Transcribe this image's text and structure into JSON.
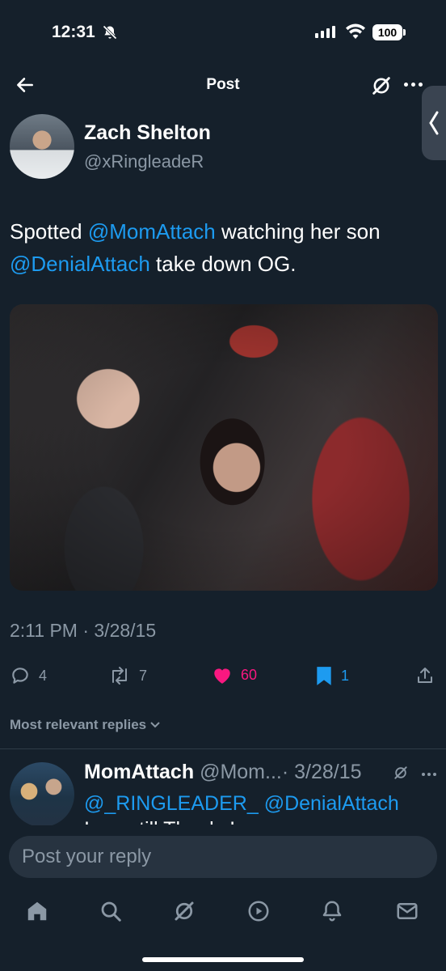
{
  "status_bar": {
    "time": "12:31",
    "battery": "100"
  },
  "header": {
    "title": "Post"
  },
  "post": {
    "author_name": "Zach Shelton",
    "author_handle": "@xRingleadeR",
    "text_part1": "Spotted ",
    "mention1": "@MomAttach",
    "text_part2": " watching her son ",
    "mention2": "@DenialAttach",
    "text_part3": " take down OG.",
    "timestamp": "2:11 PM · 3/28/15",
    "replies": "4",
    "reposts": "7",
    "likes": "60",
    "bookmarks": "1"
  },
  "replies_section": {
    "label": "Most relevant replies"
  },
  "reply": {
    "name": "MomAttach",
    "handle": "@Mom...",
    "date": "· 3/28/15",
    "mention1": "@_RINGLEADER_",
    "mention2": "@DenialAttach",
    "text_continued": "I am still Thanks!"
  },
  "compose": {
    "placeholder": "Post your reply"
  },
  "colors": {
    "accent": "#1d9bf0",
    "like": "#f91880",
    "background": "#15202b",
    "secondary_text": "#8b98a5"
  },
  "icons": [
    "back-arrow-icon",
    "grok-icon",
    "more-icon",
    "home-icon",
    "search-icon",
    "grok-icon",
    "video-icon",
    "bell-icon",
    "mail-icon"
  ]
}
